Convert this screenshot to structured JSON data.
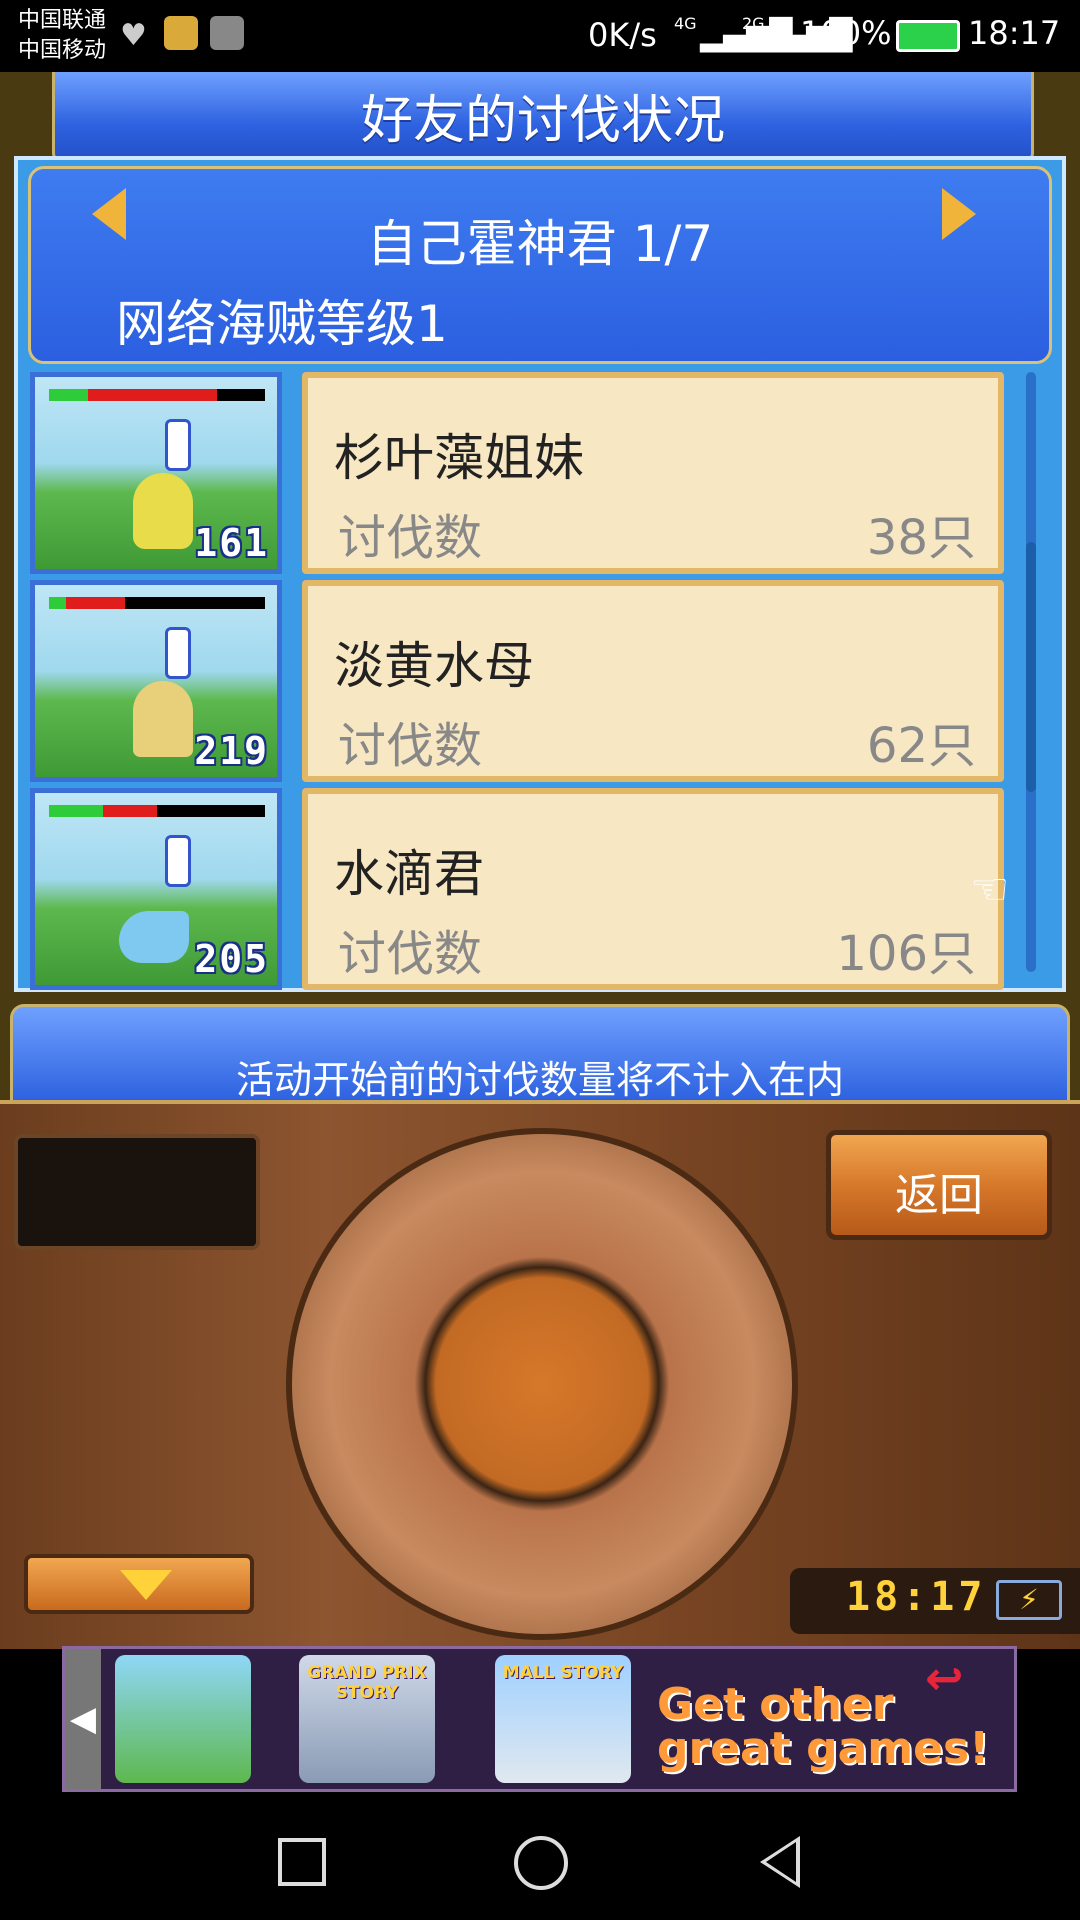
{
  "status_bar": {
    "carrier1": "中国联通",
    "carrier2": "中国移动",
    "speed": "0K/s",
    "network1": "4G",
    "network2": "2G",
    "battery": "100%",
    "time": "18:17"
  },
  "header": {
    "title": "好友的讨伐状况"
  },
  "player": {
    "name": "自己霍神君 1/7",
    "level": "网络海贼等级1"
  },
  "kill_label": "讨伐数",
  "monsters": [
    {
      "name": "杉叶藻姐妹",
      "kills": "38只",
      "level": "161",
      "hp_green": 0.18,
      "hp_red": 0.6,
      "color": "#e9dc4a"
    },
    {
      "name": "淡黄水母",
      "kills": "62只",
      "level": "219",
      "hp_green": 0.08,
      "hp_red": 0.27,
      "color": "#e8d07a"
    },
    {
      "name": "水滴君",
      "kills": "106只",
      "level": "205",
      "hp_green": 0.25,
      "hp_red": 0.25,
      "color": "#7fc8f0"
    }
  ],
  "notice": "活动开始前的讨伐数量将不计入在内",
  "console": {
    "back_label": "返回",
    "clock": "18:17"
  },
  "ad": {
    "games": [
      "GRAND PRIX STORY",
      "MALL STORY"
    ],
    "cta": "Get other great games!"
  }
}
